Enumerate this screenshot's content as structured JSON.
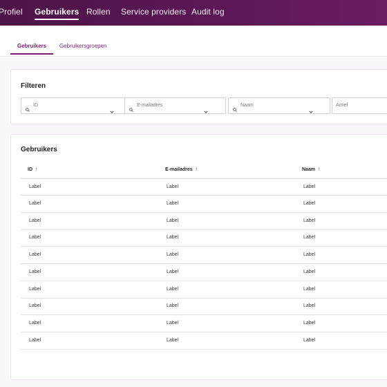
{
  "topnav": {
    "items": [
      {
        "label": "Profiel",
        "active": false
      },
      {
        "label": "Gebruikers",
        "active": true
      },
      {
        "label": "Rollen",
        "active": false
      },
      {
        "label": "Service providers",
        "active": false
      },
      {
        "label": "Audit log",
        "active": false
      }
    ]
  },
  "subtabs": [
    {
      "label": "Gebruikers",
      "active": true
    },
    {
      "label": "Gebruikersgroepen",
      "active": false
    }
  ],
  "filters": {
    "title": "Filteren",
    "fields": [
      {
        "placeholder": "ID",
        "icon": "search-icon",
        "dropdown": true
      },
      {
        "placeholder": "E-mailadres",
        "icon": "search-icon",
        "dropdown": true
      },
      {
        "placeholder": "Naam",
        "icon": "search-icon",
        "dropdown": true
      },
      {
        "placeholder": "Actief",
        "icon": null,
        "dropdown": false
      }
    ]
  },
  "table": {
    "title": "Gebruikers",
    "sort_arrow": "↑",
    "columns": [
      "ID",
      "E-mailadres",
      "Naam"
    ],
    "rows": [
      [
        "Label",
        "Label",
        "Label"
      ],
      [
        "Label",
        "Label",
        "Label"
      ],
      [
        "Label",
        "Label",
        "Label"
      ],
      [
        "Label",
        "Label",
        "Label"
      ],
      [
        "Label",
        "Label",
        "Label"
      ],
      [
        "Label",
        "Label",
        "Label"
      ],
      [
        "Label",
        "Label",
        "Label"
      ],
      [
        "Label",
        "Label",
        "Label"
      ],
      [
        "Label",
        "Label",
        "Label"
      ],
      [
        "Label",
        "Label",
        "Label"
      ]
    ]
  },
  "colors": {
    "nav_bg": "#5b1856",
    "accent": "#7a1f70",
    "page_bg": "#faf6fb"
  }
}
